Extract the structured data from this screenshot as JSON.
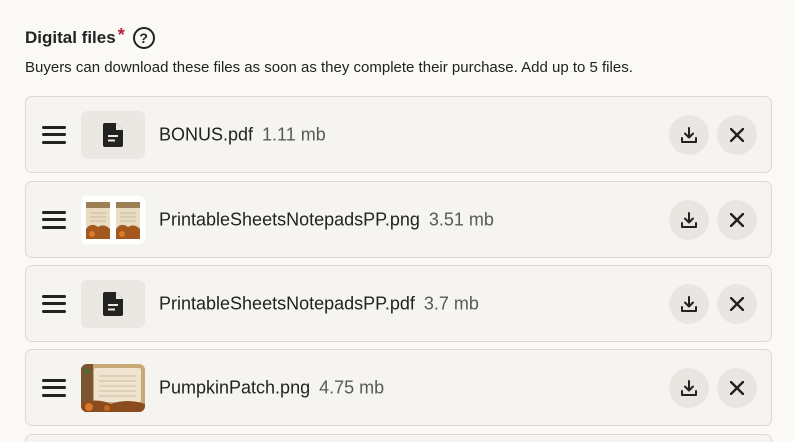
{
  "section": {
    "title": "Digital files",
    "required_mark": "*",
    "help_icon": "question-circle-icon",
    "subtitle": "Buyers can download these files as soon as they complete their purchase. Add up to 5 files."
  },
  "files": [
    {
      "name": "BONUS.pdf",
      "size": "1.11 mb",
      "thumbnail": "document-icon"
    },
    {
      "name": "PrintableSheetsNotepadsPP.png",
      "size": "3.51 mb",
      "thumbnail": "image-preview-two-sheets"
    },
    {
      "name": "PrintableSheetsNotepadsPP.pdf",
      "size": "3.7 mb",
      "thumbnail": "document-icon"
    },
    {
      "name": "PumpkinPatch.png",
      "size": "4.75 mb",
      "thumbnail": "image-preview-pumpkin-patch"
    }
  ],
  "icons": {
    "drag": "drag-handle-icon",
    "download": "download-icon",
    "remove": "close-icon"
  },
  "colors": {
    "required": "#b3203b",
    "row_background": "#f6f4f1",
    "button_background": "#e9e6e2"
  }
}
